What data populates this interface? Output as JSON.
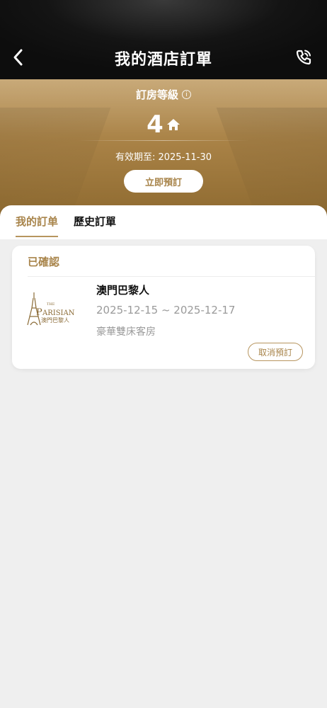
{
  "header": {
    "title": "我的酒店訂單",
    "back_icon": "chevron-left-icon",
    "phone_icon": "phone-icon"
  },
  "tier": {
    "label": "訂房等級",
    "info_icon": "info-icon",
    "level": "4",
    "level_icon": "house-icon",
    "validity": "有效期至: 2025-11-30",
    "book_button": "立即預訂"
  },
  "tabs": [
    {
      "label": "我的訂单",
      "active": true
    },
    {
      "label": "歷史訂單",
      "active": false
    }
  ],
  "orders": [
    {
      "status": "已確認",
      "hotel_name": "澳門巴黎人",
      "logo": {
        "top_text": "THE",
        "main_text": "PARISIAN",
        "sub_text": "澳門巴黎人"
      },
      "date_range": "2025-12-15 ~ 2025-12-17",
      "room_type": "豪華雙床客房",
      "cancel_button": "取消預訂"
    }
  ],
  "colors": {
    "header_bg": "#111111",
    "gold": "#a8844a",
    "gold_border": "#b7955f",
    "page_bg": "#efefef"
  }
}
